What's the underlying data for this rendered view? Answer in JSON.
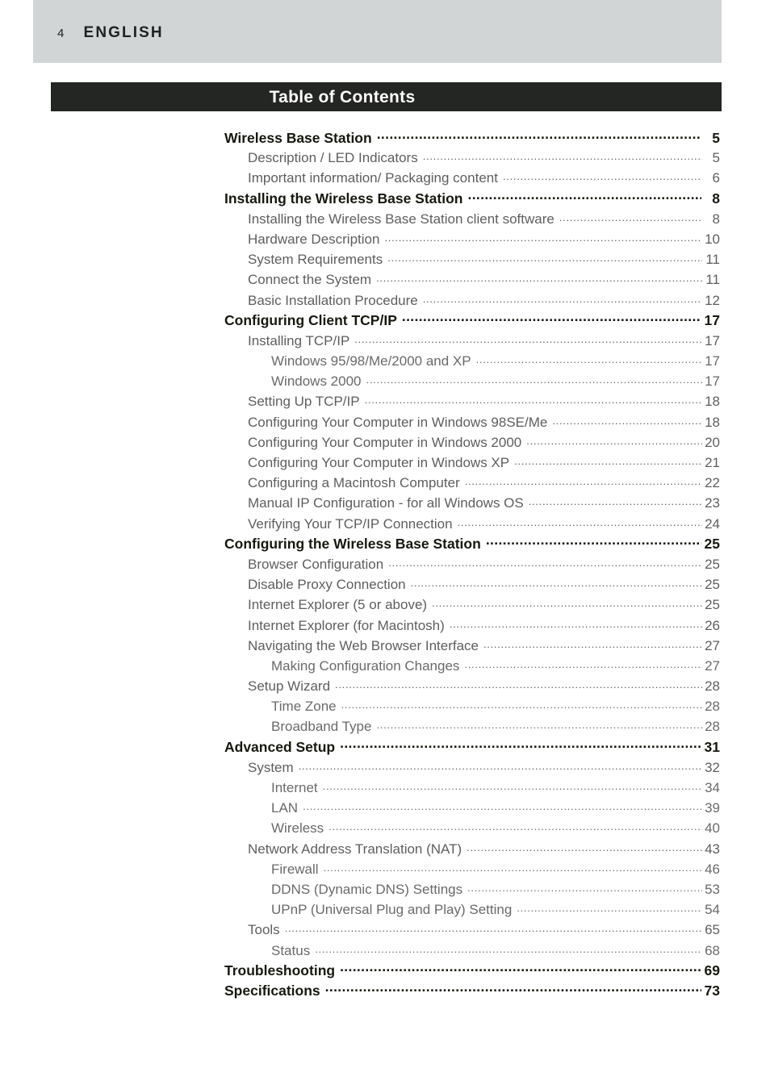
{
  "header": {
    "page_number": "4",
    "language": "ENGLISH",
    "band_color": "#d1d5d6"
  },
  "title_bar": {
    "title": "Table of Contents",
    "background_color": "#242623",
    "text_color": "#ffffff"
  },
  "toc": {
    "entries": [
      {
        "level": 0,
        "label": "Wireless Base Station",
        "page": "5"
      },
      {
        "level": 1,
        "label": "Description / LED Indicators",
        "page": "5"
      },
      {
        "level": 1,
        "label": "Important information/ Packaging content",
        "page": "6"
      },
      {
        "level": 0,
        "label": "Installing the Wireless Base Station",
        "page": "8"
      },
      {
        "level": 1,
        "label": "Installing the Wireless Base Station client software",
        "page": "8"
      },
      {
        "level": 1,
        "label": "Hardware Description",
        "page": "10"
      },
      {
        "level": 1,
        "label": "System Requirements",
        "page": "11"
      },
      {
        "level": 1,
        "label": "Connect the System",
        "page": "11"
      },
      {
        "level": 1,
        "label": "Basic Installation Procedure",
        "page": "12"
      },
      {
        "level": 0,
        "label": "Configuring Client TCP/IP",
        "page": "17"
      },
      {
        "level": 1,
        "label": "Installing TCP/IP",
        "page": "17"
      },
      {
        "level": 2,
        "label": "Windows 95/98/Me/2000 and XP",
        "page": "17"
      },
      {
        "level": 2,
        "label": "Windows 2000",
        "page": "17"
      },
      {
        "level": 1,
        "label": "Setting Up TCP/IP",
        "page": "18"
      },
      {
        "level": 1,
        "label": "Configuring Your Computer in Windows 98SE/Me",
        "page": "18"
      },
      {
        "level": 1,
        "label": "Configuring Your Computer in Windows 2000",
        "page": "20"
      },
      {
        "level": 1,
        "label": "Configuring Your Computer in Windows XP",
        "page": "21"
      },
      {
        "level": 1,
        "label": "Configuring a Macintosh Computer",
        "page": "22"
      },
      {
        "level": 1,
        "label": "Manual IP Configuration - for all Windows OS",
        "page": "23"
      },
      {
        "level": 1,
        "label": "Verifying Your TCP/IP Connection",
        "page": "24"
      },
      {
        "level": 0,
        "label": "Configuring the Wireless Base Station",
        "page": "25"
      },
      {
        "level": 1,
        "label": "Browser Configuration",
        "page": "25"
      },
      {
        "level": 1,
        "label": "Disable Proxy Connection",
        "page": "25"
      },
      {
        "level": 1,
        "label": "Internet Explorer (5 or above)",
        "page": "25"
      },
      {
        "level": 1,
        "label": "Internet Explorer (for Macintosh)",
        "page": "26"
      },
      {
        "level": 1,
        "label": "Navigating the Web Browser Interface",
        "page": "27"
      },
      {
        "level": 2,
        "label": "Making Configuration Changes",
        "page": "27"
      },
      {
        "level": 1,
        "label": "Setup Wizard",
        "page": "28"
      },
      {
        "level": 2,
        "label": "Time Zone",
        "page": "28"
      },
      {
        "level": 2,
        "label": "Broadband Type",
        "page": "28"
      },
      {
        "level": 0,
        "label": "Advanced Setup",
        "page": "31"
      },
      {
        "level": 1,
        "label": "System",
        "page": "32"
      },
      {
        "level": 2,
        "label": "Internet",
        "page": "34"
      },
      {
        "level": 2,
        "label": "LAN",
        "page": "39"
      },
      {
        "level": 2,
        "label": "Wireless",
        "page": "40"
      },
      {
        "level": 1,
        "label": "Network Address Translation (NAT)",
        "page": "43"
      },
      {
        "level": 2,
        "label": "Firewall",
        "page": "46"
      },
      {
        "level": 2,
        "label": "DDNS (Dynamic DNS) Settings",
        "page": "53"
      },
      {
        "level": 2,
        "label": "UPnP (Universal Plug and Play) Setting",
        "page": "54"
      },
      {
        "level": 1,
        "label": "Tools",
        "page": "65"
      },
      {
        "level": 2,
        "label": "Status",
        "page": "68"
      },
      {
        "level": 0,
        "label": "Troubleshooting",
        "page": "69"
      },
      {
        "level": 0,
        "label": "Specifications",
        "page": "73"
      }
    ]
  }
}
